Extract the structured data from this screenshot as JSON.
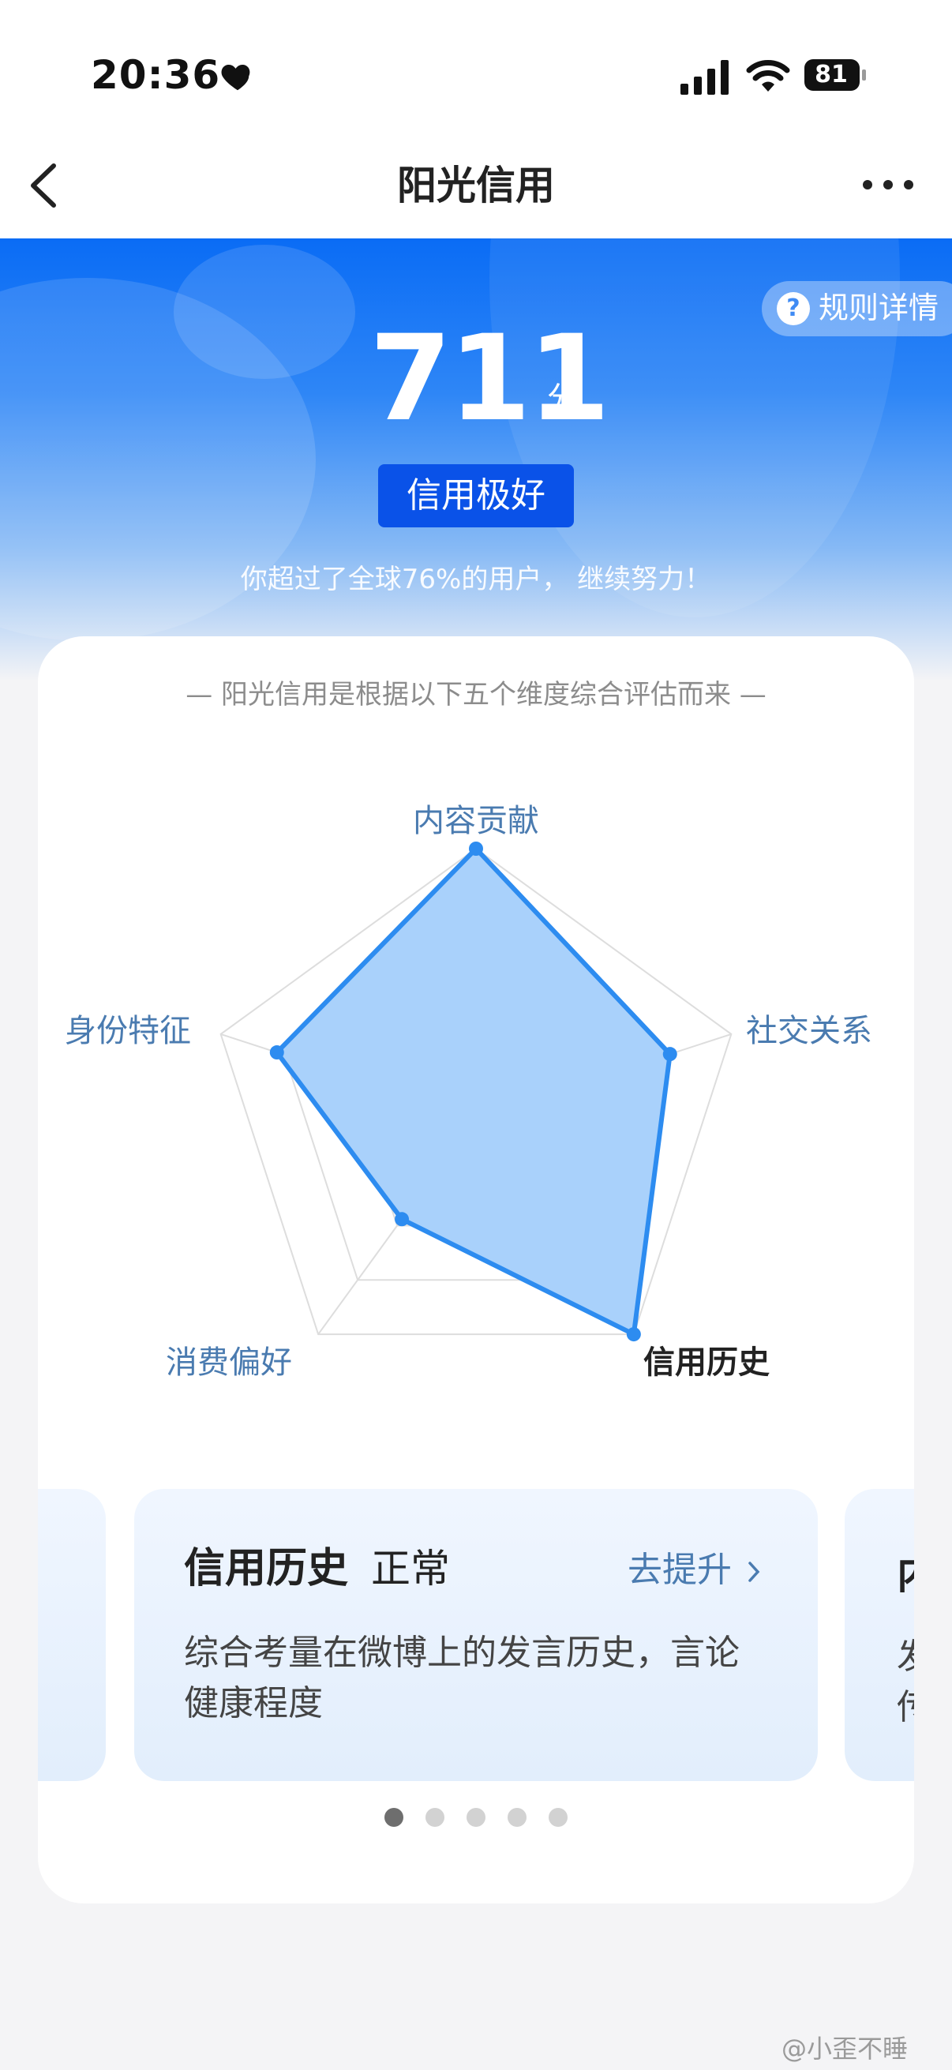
{
  "status_bar": {
    "time": "20:36",
    "battery": "81",
    "icons": [
      "heart-icon",
      "signal-icon",
      "wifi-icon",
      "battery-icon"
    ]
  },
  "nav": {
    "title": "阳光信用",
    "icons": [
      "back-icon",
      "more-icon"
    ]
  },
  "hero": {
    "rules_label": "规则详情",
    "rules_icon": "question-icon",
    "score": "711",
    "score_unit": "分",
    "level": "信用极好",
    "beat_text": "你超过了全球76%的用户， 继续努力！"
  },
  "card": {
    "subtitle": "— 阳光信用是根据以下五个维度综合评估而来 —"
  },
  "radar": {
    "axes": [
      "内容贡献",
      "社交关系",
      "信用历史",
      "消费偏好",
      "身份特征"
    ],
    "active_axis": "信用历史",
    "values": [
      1.0,
      0.76,
      1.0,
      0.47,
      0.78
    ],
    "fill_color": "#a9d1fb",
    "line_color": "#2d8cf0"
  },
  "detail": {
    "title": "信用历史",
    "status": "正常",
    "link": "去提升",
    "description": "综合考量在微博上的发言历史，言论健康程度",
    "peek_right": {
      "title": "内",
      "line1": "发",
      "line2": "传"
    }
  },
  "pagination": {
    "count": 5,
    "active": 0
  },
  "watermark": "@小歪不睡"
}
